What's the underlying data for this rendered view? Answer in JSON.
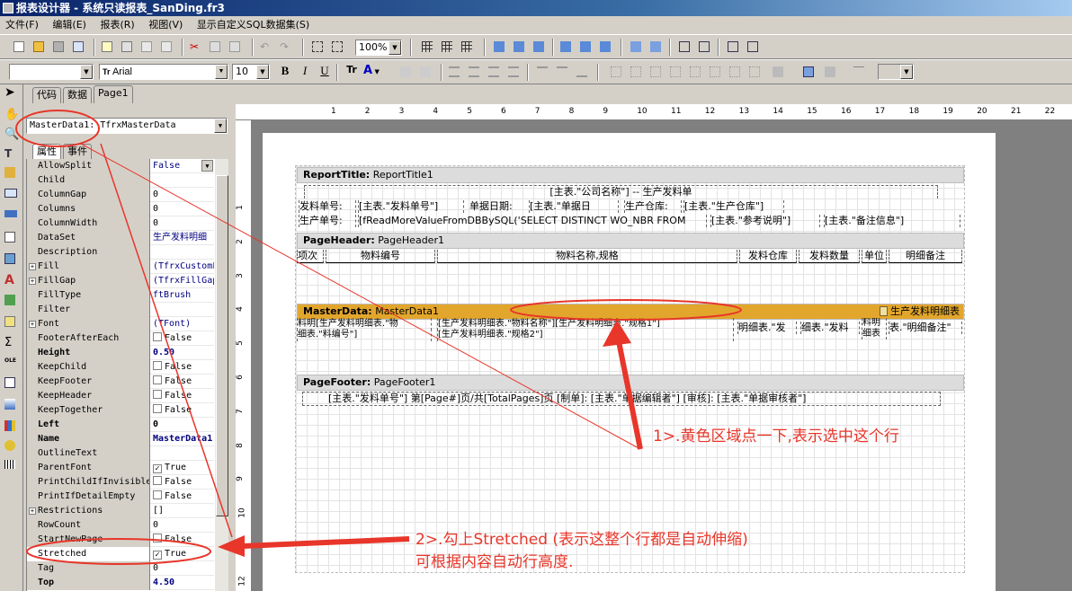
{
  "window": {
    "title": "报表设计器 - 系统只读报表_SanDing.fr3"
  },
  "menu": [
    "文件(F)",
    "编辑(E)",
    "报表(R)",
    "视图(V)",
    "显示自定义SQL数据集(S)"
  ],
  "toolbar": {
    "zoom": "100%",
    "font_name": "Arial",
    "font_size": "10"
  },
  "tabs": {
    "code": "代码",
    "data": "数据",
    "page1": "Page1"
  },
  "inspector": {
    "object": "MasterData1: TfrxMasterData",
    "tab_props": "属性",
    "tab_events": "事件",
    "properties": [
      {
        "name": "AllowSplit",
        "value": "False",
        "kind": "combo"
      },
      {
        "name": "Child",
        "value": ""
      },
      {
        "name": "ColumnGap",
        "value": "0"
      },
      {
        "name": "Columns",
        "value": "0"
      },
      {
        "name": "ColumnWidth",
        "value": "0"
      },
      {
        "name": "DataSet",
        "value": "生产发料明细"
      },
      {
        "name": "Description",
        "value": ""
      },
      {
        "name": "Fill",
        "value": "(TfrxCustomF",
        "expand": true
      },
      {
        "name": "FillGap",
        "value": "(TfrxFillGap",
        "expand": true
      },
      {
        "name": "FillType",
        "value": "ftBrush"
      },
      {
        "name": "Filter",
        "value": ""
      },
      {
        "name": "Font",
        "value": "(TFont)",
        "expand": true
      },
      {
        "name": "FooterAfterEach",
        "value": "False",
        "check": "off"
      },
      {
        "name": "Height",
        "value": "0.50",
        "bold": true
      },
      {
        "name": "KeepChild",
        "value": "False",
        "check": "off"
      },
      {
        "name": "KeepFooter",
        "value": "False",
        "check": "off"
      },
      {
        "name": "KeepHeader",
        "value": "False",
        "check": "off"
      },
      {
        "name": "KeepTogether",
        "value": "False",
        "check": "off"
      },
      {
        "name": "Left",
        "value": "0",
        "bold": true
      },
      {
        "name": "Name",
        "value": "MasterData1",
        "bold": true
      },
      {
        "name": "OutlineText",
        "value": ""
      },
      {
        "name": "ParentFont",
        "value": "True",
        "check": "on"
      },
      {
        "name": "PrintChildIfInvisible",
        "value": "False",
        "check": "off"
      },
      {
        "name": "PrintIfDetailEmpty",
        "value": "False",
        "check": "off"
      },
      {
        "name": "Restrictions",
        "value": "[]",
        "expand": true
      },
      {
        "name": "RowCount",
        "value": "0"
      },
      {
        "name": "StartNewPage",
        "value": "False",
        "check": "off"
      },
      {
        "name": "Stretched",
        "value": "True",
        "check": "on"
      },
      {
        "name": "Tag",
        "value": "0"
      },
      {
        "name": "Top",
        "value": "4.50",
        "bold": true
      }
    ]
  },
  "ruler": {
    "h": [
      "1",
      "2",
      "3",
      "4",
      "5",
      "6",
      "7",
      "8",
      "9",
      "10",
      "11",
      "12",
      "13",
      "14",
      "15",
      "16",
      "17",
      "18",
      "19",
      "20",
      "21",
      "22"
    ],
    "v": [
      "1",
      "2",
      "3",
      "4",
      "5",
      "6",
      "7",
      "8",
      "9",
      "10",
      "11",
      "12"
    ]
  },
  "report": {
    "report_title": {
      "band": "ReportTitle:",
      "name": "ReportTitle1",
      "line1": "[主表.\"公司名称\"] -- 生产发料单",
      "l2a": "发料单号:",
      "l2b": "[主表.\"发料单号\"]",
      "l2c": "单据日期:",
      "l2d": "[主表.\"单据日",
      "l2e": "生产仓库:",
      "l2f": "[主表.\"生产仓库\"]",
      "l3a": "生产单号:",
      "l3b": "[fReadMoreValueFromDBBySQL('SELECT DISTINCT WO_NBR FROM",
      "l3c": "[主表.\"参考说明\"]",
      "l3d": "[主表.\"备注信息\"]"
    },
    "page_header": {
      "band": "PageHeader:",
      "name": "PageHeader1",
      "cols": [
        "项次",
        "物料编号",
        "物料名称,规格",
        "发料仓库",
        "发料数量",
        "单位",
        "明细备注"
      ]
    },
    "master_data": {
      "band": "MasterData:",
      "name": "MasterData1",
      "dataset": "生产发料明细表",
      "r1a": "料明[生产发料明细表.\"物",
      "r1b": "[生产发料明细表.\"物料名称\"][生产发料明细表.\"规格1\"]",
      "r2a": "细表.\"料编号\"]",
      "r2b": "[生产发料明细表.\"规格2\"]",
      "c3": "明细表.\"发",
      "c4": "细表.\"发料",
      "c5": "料明细表",
      "c6": "表.\"明细备注\""
    },
    "page_footer": {
      "band": "PageFooter:",
      "name": "PageFooter1",
      "line": "[主表.\"发料单号\"]   第[Page#]页/共[TotalPages]页 [制单]: [主表.\"单据编辑者\"] [审核]: [主表.\"单据审核者\"]"
    }
  },
  "annotations": {
    "note1": "1>.黄色区域点一下,表示选中这个行",
    "note2a": "2>.勾上Stretched (表示这整个行都是自动伸缩)",
    "note2b": "可根据内容自动行高度."
  },
  "colors": {
    "master_band": "#e2a62c",
    "annotation": "#e8362a",
    "title_bar": "#0a246a"
  }
}
